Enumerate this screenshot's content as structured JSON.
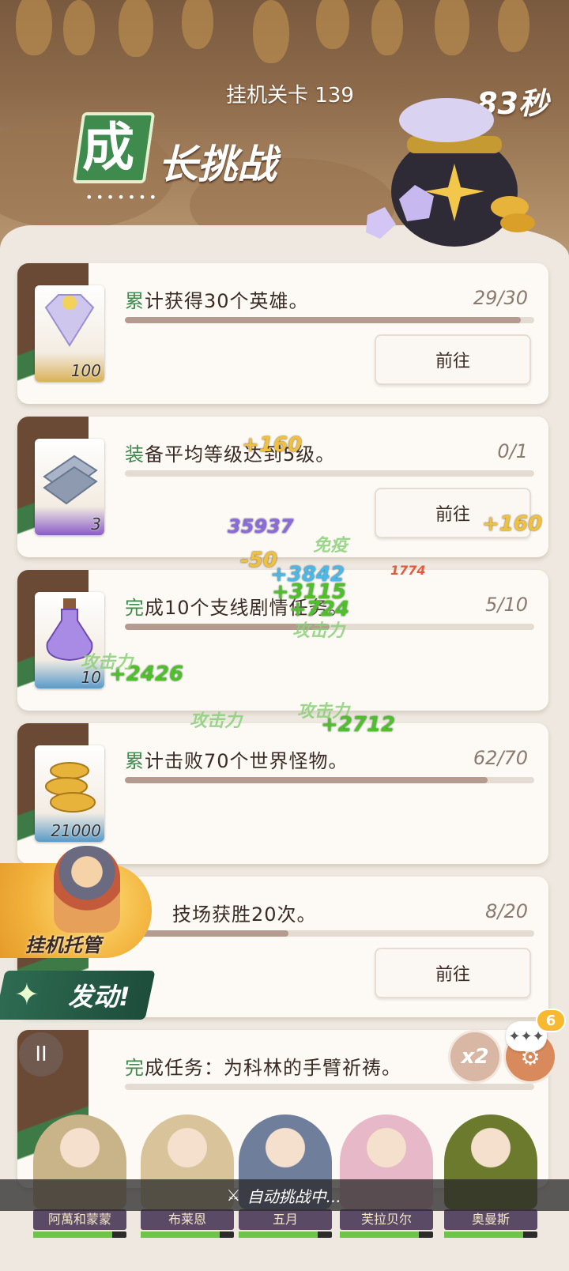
{
  "header": {
    "stage_label": "挂机关卡 139",
    "timer": "83秒",
    "title_badge_char": "成",
    "title_rest": "长挑战",
    "title_dots": "•••••••"
  },
  "tasks": [
    {
      "prefix": "累",
      "text": "计获得30个英雄。",
      "progress": "29/30",
      "fraction": 0.967,
      "reward_icon": "diamond-icon",
      "reward_qty": "100",
      "go_label": "前往"
    },
    {
      "prefix": "装",
      "text": "备平均等级达到5级。",
      "progress": "0/1",
      "fraction": 0.0,
      "reward_icon": "silver-ingot-icon",
      "reward_qty": "3",
      "go_label": "前往"
    },
    {
      "prefix": "完",
      "text": "成10个支线剧情任务。",
      "progress": "5/10",
      "fraction": 0.5,
      "reward_icon": "potion-icon",
      "reward_qty": "10",
      "go_label": ""
    },
    {
      "prefix": "累",
      "text": "计击败70个世界怪物。",
      "progress": "62/70",
      "fraction": 0.886,
      "reward_icon": "gold-coins-icon",
      "reward_qty": "21000",
      "go_label": ""
    },
    {
      "prefix": "",
      "text": "技场获胜20次。",
      "progress": "8/20",
      "fraction": 0.4,
      "reward_icon": "",
      "reward_qty": "",
      "go_label": "前往"
    },
    {
      "prefix": "完",
      "text": "成任务：为科林的手臂祈祷。",
      "progress": "",
      "fraction": 0.0,
      "reward_icon": "",
      "reward_qty": "",
      "go_label": ""
    }
  ],
  "combat_fx": {
    "fx1": "+160",
    "fx2": "+160",
    "fx3": "35937",
    "fx4": "免疫",
    "fx5": "-50",
    "fx6": "+3842",
    "fx7": "1774",
    "fx8": "+3115",
    "fx9": "+724",
    "fx10": "攻击力",
    "fx11": "+2426",
    "fx12": "攻击力",
    "fx13": "攻击力",
    "fx14": "+2712",
    "fx15": "攻击力"
  },
  "controls": {
    "idle_label": "挂机托管",
    "launch_label": "发动!",
    "pause": "II",
    "speed": "x2",
    "notif_count": "6",
    "auto_status": "自动挑战中..."
  },
  "team": [
    {
      "name": "阿萬和蒙蒙",
      "color": "#c9b48a"
    },
    {
      "name": "布莱恩",
      "color": "#d8c39a"
    },
    {
      "name": "五月",
      "color": "#6f7e9a"
    },
    {
      "name": "芙拉贝尔",
      "color": "#e6b8c8"
    },
    {
      "name": "奥曼斯",
      "color": "#6b7a2c"
    }
  ]
}
